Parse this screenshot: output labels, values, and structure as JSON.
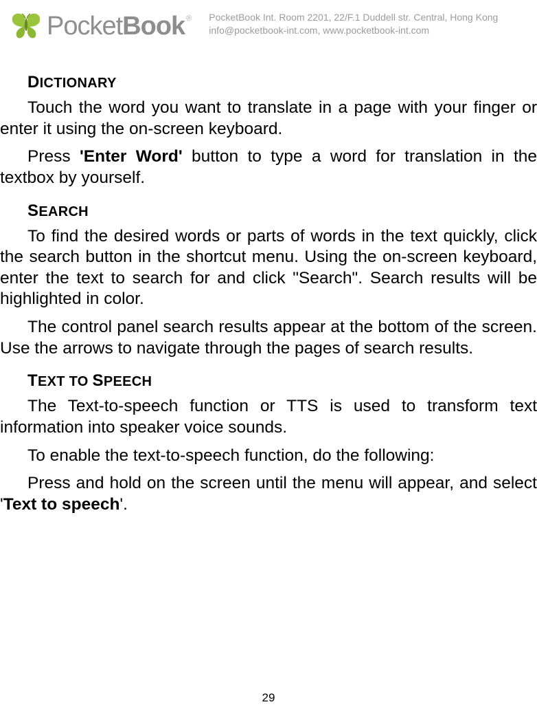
{
  "header": {
    "brand_light": "Pocket",
    "brand_bold": "Book",
    "address_line1": "PocketBook Int. Room 2201, 22/F.1 Duddell str. Central, Hong Kong",
    "address_line2": "info@pocketbook-int.com, www.pocketbook-int.com"
  },
  "sections": {
    "dictionary": {
      "heading_first": "D",
      "heading_rest": "ICTIONARY",
      "p1": "Touch the word you want to translate in a page with your finger or enter it using the on-screen keyboard.",
      "p2_pre": "Press ",
      "p2_bold": "'Enter Word'",
      "p2_post": " button to type a word for translation in the textbox by yourself."
    },
    "search": {
      "heading_first": "S",
      "heading_rest": "EARCH",
      "p1": "To find the desired words or parts of words in the text quickly, click the search button in the shortcut menu. Using the on-screen keyboard, enter the text to search for and click \"Search\". Search results will be highlighted in color.",
      "p2": "The control panel search results appear at the bottom of the screen. Use the arrows to navigate through the pages of search results."
    },
    "tts": {
      "heading_first1": "T",
      "heading_rest1": "EXT TO ",
      "heading_first2": "S",
      "heading_rest2": "PEECH",
      "p1": "The Text-to-speech function or TTS is used to transform text information into speaker voice sounds.",
      "p2": "To enable the text-to-speech function, do the following:",
      "p3_pre": "Press and hold on the screen until the menu will appear, and select '",
      "p3_bold": "Text to speech",
      "p3_post": "'."
    }
  },
  "page_number": "29"
}
